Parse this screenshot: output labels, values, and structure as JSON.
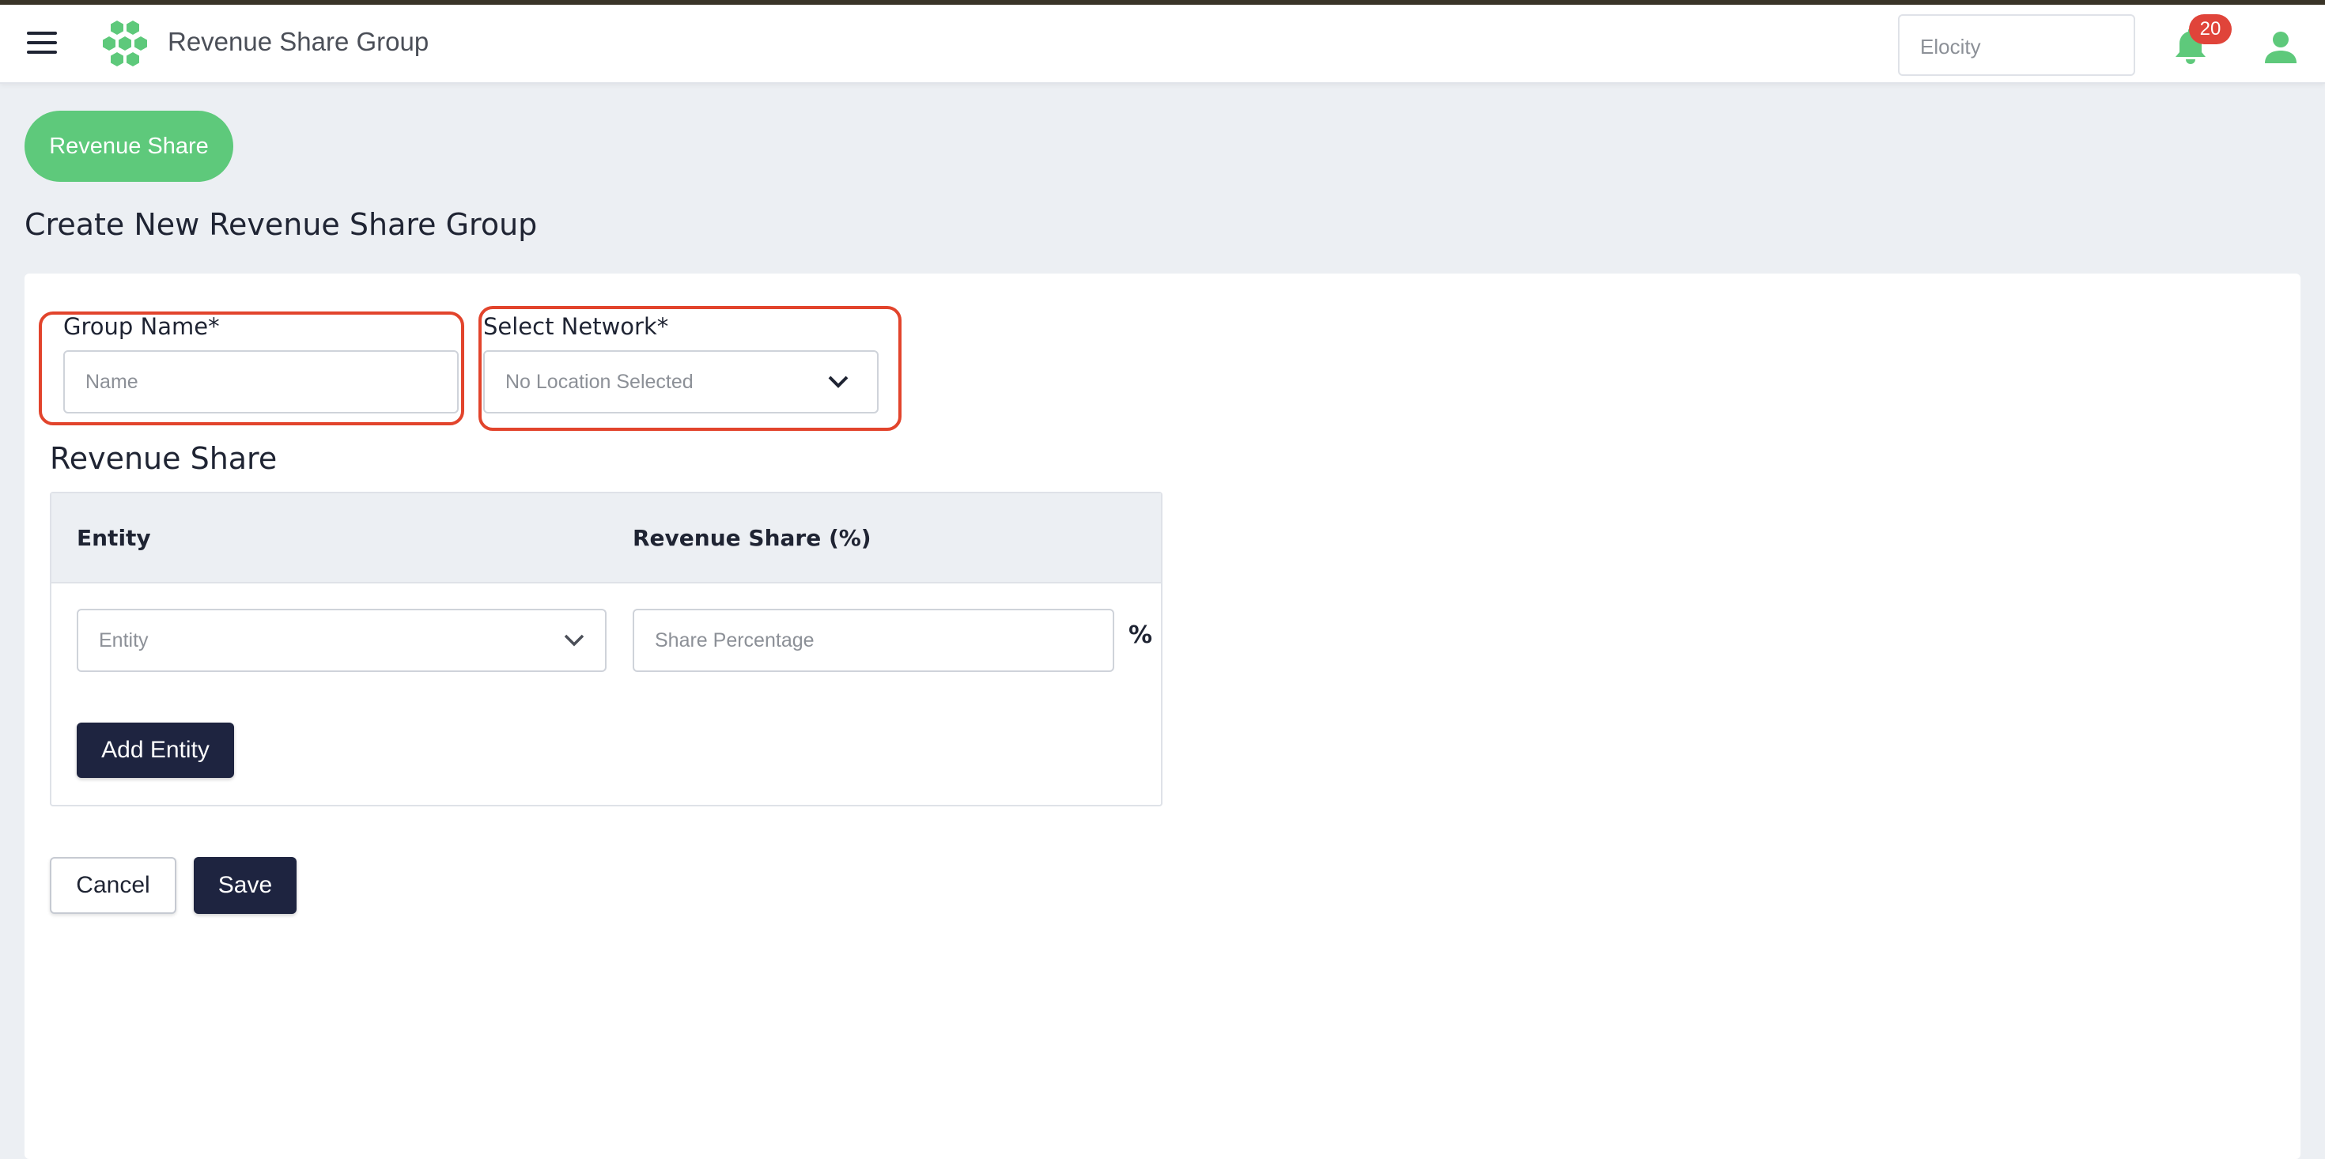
{
  "header": {
    "title": "Revenue Share Group",
    "org_selector_value": "Elocity",
    "notification_count": "20",
    "icons": [
      "hamburger-menu-icon",
      "hexagon-logo-icon",
      "bell-icon",
      "user-icon"
    ]
  },
  "page": {
    "pill_label": "Revenue Share",
    "heading": "Create New Revenue Share Group"
  },
  "form": {
    "group_name_label": "Group Name*",
    "group_name_placeholder": "Name",
    "network_label": "Select Network*",
    "network_value": "No Location Selected"
  },
  "revenue_share": {
    "section_title": "Revenue Share",
    "columns": [
      "Entity",
      "Revenue Share (%)"
    ],
    "rows": [
      {
        "entity_placeholder": "Entity",
        "share_placeholder": "Share Percentage",
        "unit": "%"
      }
    ],
    "add_button": "Add Entity"
  },
  "actions": {
    "cancel": "Cancel",
    "save": "Save"
  },
  "colors": {
    "accent_green": "#5ec97b",
    "dark_navy": "#1e2440",
    "highlight_red": "#e2442c",
    "badge_red": "#e0443a",
    "background": "#eceff3"
  }
}
